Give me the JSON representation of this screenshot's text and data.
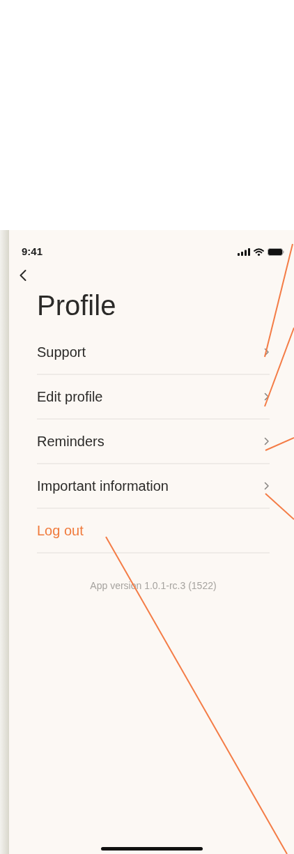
{
  "status_bar": {
    "time": "9:41"
  },
  "title": "Profile",
  "menu_items": [
    {
      "kind": "link",
      "label": "Support"
    },
    {
      "kind": "link",
      "label": "Edit profile"
    },
    {
      "kind": "link",
      "label": "Reminders"
    },
    {
      "kind": "link",
      "label": "Important information"
    },
    {
      "kind": "action",
      "label": "Log out"
    }
  ],
  "app_version": "App version 1.0.1-rc.3 (1522)"
}
